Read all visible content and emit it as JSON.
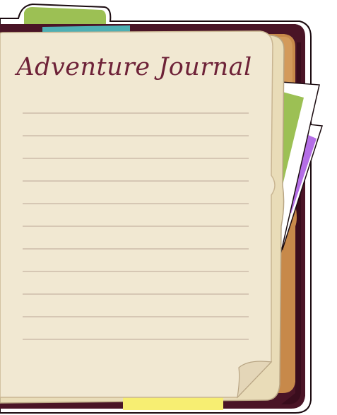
{
  "journal": {
    "title": "Adventure Journal",
    "line_count": 11
  },
  "colors": {
    "binder_dark": "#4a1426",
    "binder_darker": "#3a0d1d",
    "outline": "#1b0b10",
    "folder_orange": "#c7894a",
    "folder_orange_light": "#d39a5b",
    "paper_back": "#e9dcb8",
    "paper_front": "#f1e8d2",
    "ruled_line": "#cdbca9",
    "title": "#6e2238",
    "tab_green": "#9cc054",
    "tab_teal": "#4dafb4",
    "tab_yellow": "#f7ee72",
    "photo_frame": "#ffffff",
    "photo_green": "#9cc054",
    "photo_purple": "#b46ee6"
  }
}
